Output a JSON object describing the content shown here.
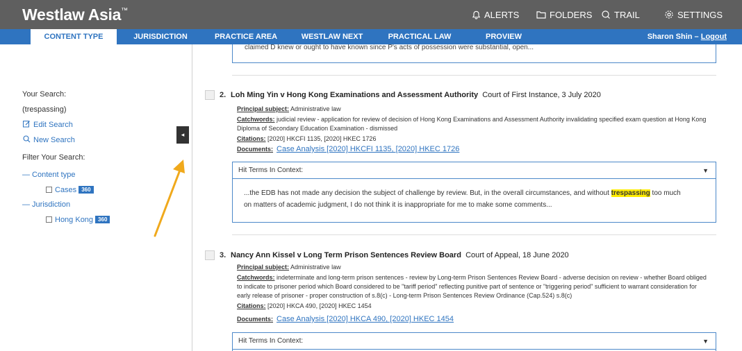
{
  "app": {
    "brand": "Westlaw Asia",
    "brand_mark": "™",
    "top_nav": [
      {
        "label": "ALERTS",
        "icon": "bell-icon"
      },
      {
        "label": "FOLDERS",
        "icon": "folder-icon"
      },
      {
        "label": "TRAIL",
        "icon": "trail-icon"
      },
      {
        "label": "SETTINGS",
        "icon": "gear-icon"
      }
    ]
  },
  "nav": {
    "items": [
      "CONTENT TYPE",
      "JURISDICTION",
      "PRACTICE AREA",
      "WESTLAW NEXT",
      "PRACTICAL LAW",
      "PROVIEW"
    ],
    "active": "CONTENT TYPE",
    "user_name": "Sharon Shin",
    "separator": "–",
    "logout": "Logout"
  },
  "sidebar": {
    "your_search_label": "Your Search:",
    "search_query": "(trespassing)",
    "edit_search": "Edit Search",
    "new_search": "New Search",
    "filter_label": "Filter Your Search:",
    "content_type_heading": "— Content type",
    "cases_label": "Cases",
    "cases_count": "360",
    "jurisdiction_heading": "— Jurisdiction",
    "hk_label": "Hong Kong",
    "hk_count": "360",
    "collapse_glyph": "◂"
  },
  "results": {
    "prev_snippet": "claimed D knew or ought to have known since P's acts of possession were substantial, open...",
    "items": [
      {
        "number": "2.",
        "title": "Loh Ming Yin v Hong Kong Examinations and Assessment Authority",
        "court_date": "Court of First Instance, 3 July 2020",
        "principal_label": "Principal subject:",
        "principal": "Administrative law",
        "catchwords_label": "Catchwords:",
        "catchwords_1": "judicial review - application for review of decision of Hong Kong Examinations and Assessment Authority invalidating specified exam question at Hong Kong",
        "catchwords_2": "Diploma of Secondary Education Examination - dismissed",
        "citations_label": "Citations:",
        "citations": "[2020] HKCFI 1135, [2020] HKEC 1726",
        "documents_label": "Documents:",
        "documents": "Case Analysis  [2020] HKCFI 1135,  [2020] HKEC 1726",
        "hit_label": "Hit Terms In Context:",
        "hit_pre": "...the EDB has not made any decision the subject of challenge by review. But, in the overall circumstances, and without",
        "hit_term": "trespassing",
        "hit_post": " too much",
        "hit_line2": "on matters of academic judgment, I do not think it is inappropriate for me to make some comments..."
      },
      {
        "number": "3.",
        "title": "Nancy Ann Kissel v Long Term Prison Sentences Review Board",
        "court_date": "Court of Appeal, 18 June 2020",
        "principal_label": "Principal subject:",
        "principal": "Administrative law",
        "catchwords_label": "Catchwords:",
        "catchwords_1": "indeterminate and long-term prison sentences - review by Long-term Prison Sentences Review Board - adverse decision on review - whether Board obliged",
        "catchwords_2": "to indicate to prisoner period which Board considered to be \"tariff period\" reflecting punitive part of sentence or \"triggering period\" sufficient to warrant consideration for",
        "catchwords_3": "early release of prisoner - proper construction of s.8(c) - Long-term Prison Sentences Review Ordinance (Cap.524) s.8(c)",
        "citations_label": "Citations:",
        "citations": "[2020] HKCA 490, [2020] HKEC 1454",
        "documents_label": "Documents:",
        "documents": "Case Analysis  [2020] HKCA 490,  [2020] HKEC 1454",
        "hit_label": "Hit Terms In Context:"
      }
    ]
  },
  "colors": {
    "topbar": "#5f5f5f",
    "navbar": "#2f74c0",
    "accent": "#2f74c0",
    "highlight": "#ffec00",
    "annotation_arrow": "#f0a91c"
  }
}
